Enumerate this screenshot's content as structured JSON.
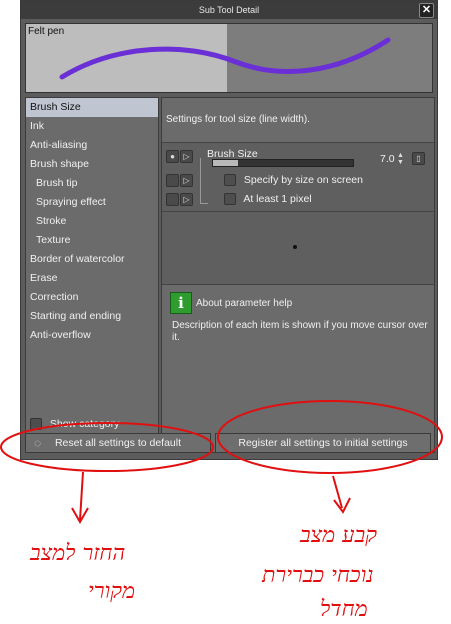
{
  "window": {
    "title": "Sub Tool Detail",
    "close_glyph": "✕",
    "preview_label": "Felt pen",
    "stroke_color": "#6a2fd6"
  },
  "categories": [
    {
      "label": "Brush Size",
      "selected": true
    },
    {
      "label": "Ink"
    },
    {
      "label": "Anti-aliasing"
    },
    {
      "label": "Brush shape"
    },
    {
      "label": "Brush tip",
      "sub": true
    },
    {
      "label": "Spraying effect",
      "sub": true
    },
    {
      "label": "Stroke",
      "sub": true
    },
    {
      "label": "Texture",
      "sub": true
    },
    {
      "label": "Border of watercolor"
    },
    {
      "label": "Erase"
    },
    {
      "label": "Correction"
    },
    {
      "label": "Starting and ending"
    },
    {
      "label": "Anti-overflow"
    }
  ],
  "show_category_label": "Show category",
  "settings": {
    "description": "Settings for tool size (line width).",
    "brush_size_label": "Brush Size",
    "brush_size_value": "7.0",
    "brush_size_fill": 0.18,
    "opt_specify": "Specify by size on screen",
    "opt_least": "At least 1 pixel"
  },
  "help": {
    "icon_glyph": "i",
    "title": "About parameter help",
    "text": "Description of each item is shown if you move cursor over it."
  },
  "buttons": {
    "reset": "Reset all settings to default",
    "register": "Register all settings to initial settings"
  },
  "annotations": {
    "color": "#e01010",
    "left_line1": "החזר למצב",
    "left_line2": "מקורי",
    "right_line1": "קבע מצב",
    "right_line2": "נוכחי כברירת",
    "right_line3": "מחדל"
  }
}
